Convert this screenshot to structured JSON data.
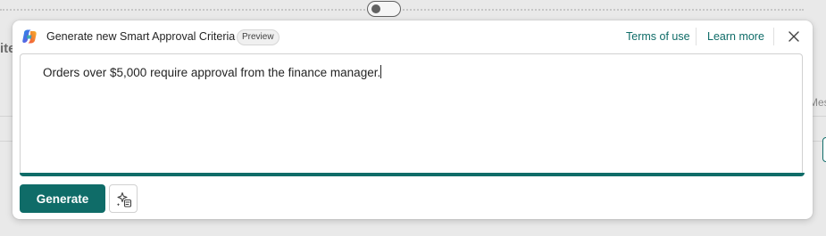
{
  "background": {
    "left_text": "ite",
    "right_text": "Mes"
  },
  "dialog": {
    "title": "Generate new Smart Approval Criteria",
    "badge": "Preview",
    "links": {
      "terms": "Terms of use",
      "learn": "Learn more"
    },
    "prompt_text": "Orders over $5,000 require approval from the finance manager.",
    "generate_label": "Generate",
    "icons": {
      "app": "copilot-icon",
      "close": "close-icon",
      "prompt_guide": "sparkle-prompt-icon"
    },
    "colors": {
      "accent": "#0f6c68",
      "link": "#0f6c68"
    }
  }
}
